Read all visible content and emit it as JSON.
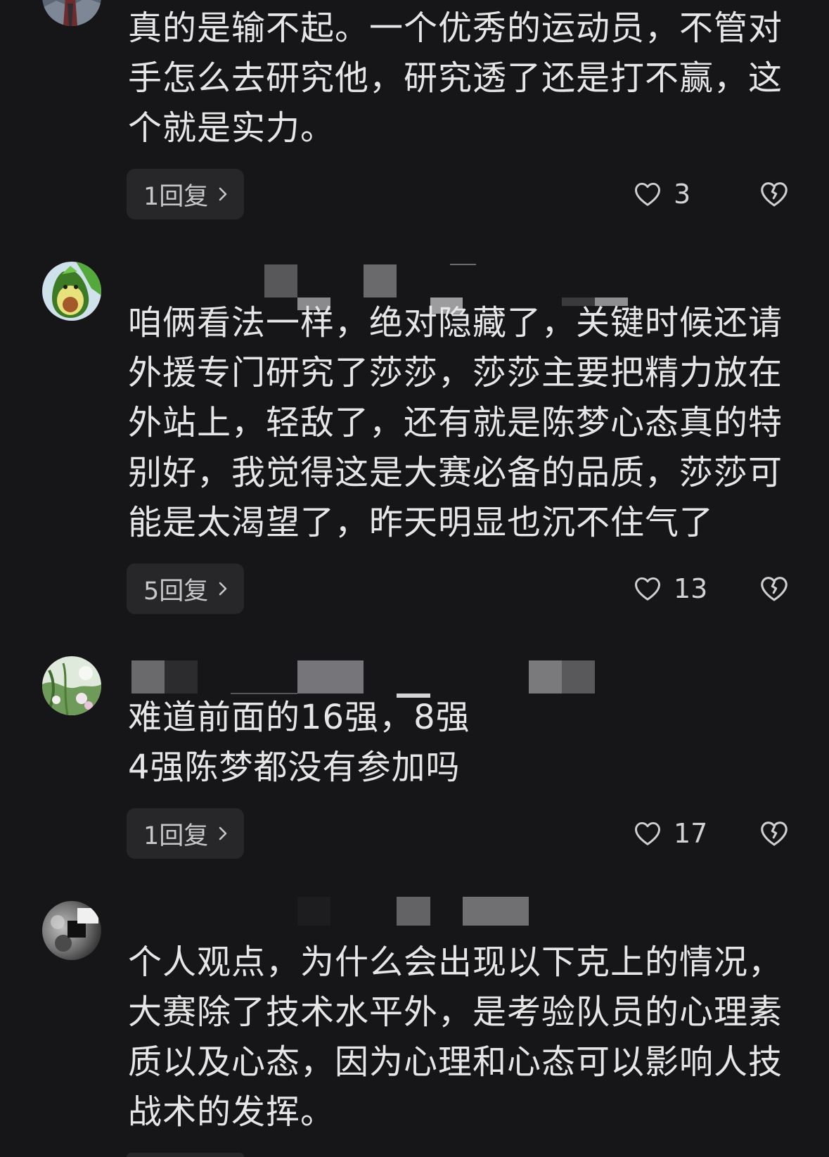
{
  "comments": [
    {
      "text": "真的是输不起。一个优秀的运动员，不管对手怎么去研究他，研究透了还是打不赢，这个就是实力。",
      "reply_label": "1回复",
      "like_count": "3"
    },
    {
      "text": "咱俩看法一样，绝对隐藏了，关键时候还请外援专门研究了莎莎，莎莎主要把精力放在外站上，轻敌了，还有就是陈梦心态真的特别好，我觉得这是大赛必备的品质，莎莎可能是太渴望了，昨天明显也沉不住气了",
      "reply_label": "5回复",
      "like_count": "13"
    },
    {
      "text": "难道前面的16强，8强\n4强陈梦都没有参加吗",
      "reply_label": "1回复",
      "like_count": "17"
    },
    {
      "text": "个人观点，为什么会出现以下克上的情况，大赛除了技术水平外，是考验队员的心理素质以及心态，因为心理和心态可以影响人技战术的发挥。"
    }
  ],
  "icons": {
    "like": "heart-outline-icon",
    "dislike": "broken-heart-icon",
    "reply_chevron": "chevron-right-icon"
  },
  "colors": {
    "background": "#161618",
    "comment_text": "#e6e6e6",
    "reply_button_bg": "#27272a",
    "reply_button_text": "#c8c8ca",
    "icon": "#cfcfd1"
  }
}
